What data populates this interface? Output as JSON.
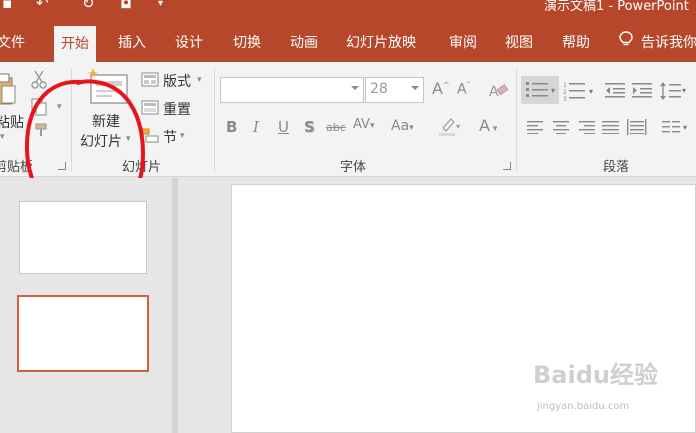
{
  "app": {
    "title": "演示文稿1 - PowerPoint",
    "theme_color": "#b7472a"
  },
  "quick_access": [
    "save-icon",
    "undo-icon",
    "redo-icon",
    "from-beginning-icon",
    "customize-dropdown-icon"
  ],
  "tabs": [
    {
      "label": "文件",
      "active": false
    },
    {
      "label": "开始",
      "active": true
    },
    {
      "label": "插入",
      "active": false
    },
    {
      "label": "设计",
      "active": false
    },
    {
      "label": "切换",
      "active": false
    },
    {
      "label": "动画",
      "active": false
    },
    {
      "label": "幻灯片放映",
      "active": false
    },
    {
      "label": "审阅",
      "active": false
    },
    {
      "label": "视图",
      "active": false
    },
    {
      "label": "帮助",
      "active": false
    }
  ],
  "tell_me": "告诉我你",
  "ribbon": {
    "clipboard": {
      "label": "剪贴板",
      "paste_label": "粘贴"
    },
    "slides": {
      "label": "幻灯片",
      "new_slide_line1": "新建",
      "new_slide_line2": "幻灯片",
      "layout_label": "版式",
      "reset_label": "重置",
      "section_label": "节"
    },
    "font": {
      "label": "字体",
      "font_name": "",
      "font_size": "28"
    },
    "paragraph": {
      "label": "段落"
    }
  },
  "slides_pane": {
    "thumbnails": [
      {
        "selected": false
      },
      {
        "selected": true,
        "border_color": "#d2603c"
      }
    ]
  },
  "annotation": {
    "shape": "hand-drawn-ellipse",
    "color": "#e8141c"
  },
  "watermark": {
    "brand": "Baidu经验",
    "url": "jingyan.baidu.com"
  }
}
